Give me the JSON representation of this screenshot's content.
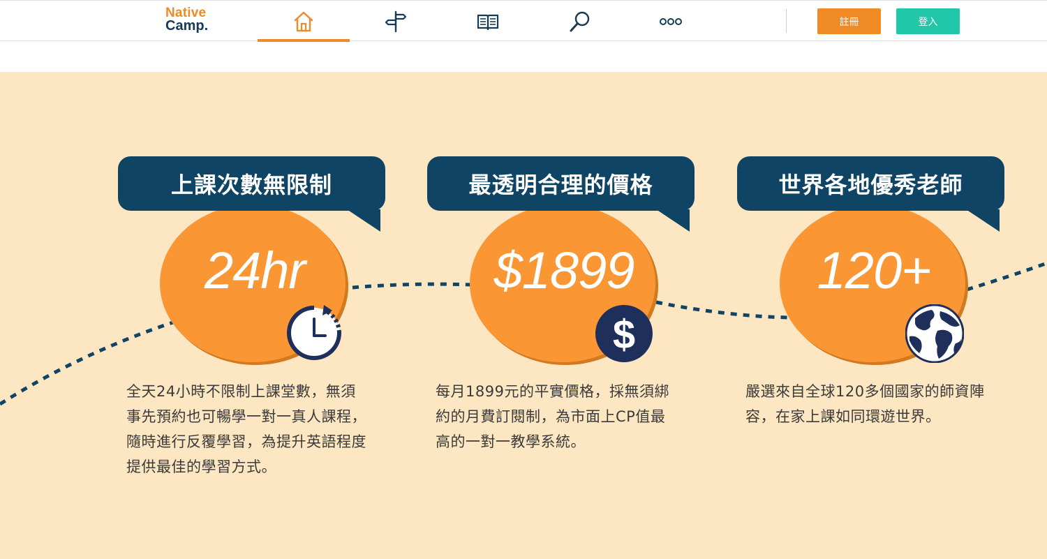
{
  "header": {
    "logo_line1": "Native",
    "logo_line2": "Camp.",
    "nav": [
      {
        "icon": "home-icon",
        "active": true
      },
      {
        "icon": "signpost-icon",
        "active": false
      },
      {
        "icon": "book-icon",
        "active": false
      },
      {
        "icon": "search-icon",
        "active": false
      },
      {
        "icon": "more-icon",
        "active": false
      }
    ],
    "register_label": "註冊",
    "login_label": "登入"
  },
  "features": [
    {
      "title": "上課次數無限制",
      "big": "24hr",
      "icon": "clock-icon",
      "desc": "全天24小時不限制上課堂數，無須事先預約也可暢學一對一真人課程，隨時進行反覆學習，為提升英語程度提供最佳的學習方式。"
    },
    {
      "title": "最透明合理的價格",
      "big": "$1899",
      "icon": "dollar-icon",
      "desc": "每月1899元的平實價格，採無須綁約的月費訂閱制，為市面上CP值最高的一對一教學系統。"
    },
    {
      "title": "世界各地優秀老師",
      "big": "120+",
      "icon": "globe-icon",
      "desc": "嚴選來自全球120多個國家的師資陣容，在家上課如同環遊世界。"
    }
  ],
  "colors": {
    "accent_orange": "#f08a24",
    "accent_teal": "#22c7a9",
    "navy": "#0f4465",
    "section_bg": "#fde7c2"
  }
}
